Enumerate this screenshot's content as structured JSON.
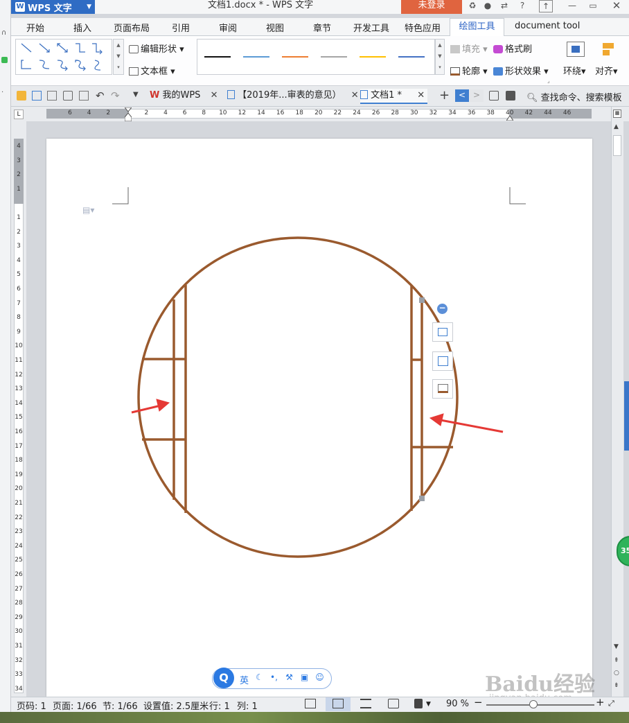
{
  "app": {
    "name": "WPS 文字",
    "window_title": "文档1.docx * - WPS 文字",
    "login_label": "未登录"
  },
  "menu": {
    "tabs": [
      "开始",
      "插入",
      "页面布局",
      "引用",
      "审阅",
      "视图",
      "章节",
      "开发工具",
      "特色应用"
    ],
    "active_tab": "绘图工具",
    "extra_tab": "document tool"
  },
  "ribbon": {
    "edit_shape": "编辑形状",
    "text_box": "文本框",
    "fill": "填充",
    "format_painter": "格式刷",
    "outline": "轮廓",
    "shape_effects": "形状效果",
    "wrap": "环绕",
    "align": "对齐",
    "line_colors": [
      "#111111",
      "#5b9bd5",
      "#ed7d31",
      "#a5a5a5",
      "#ffc000",
      "#4472c4"
    ]
  },
  "doc_tabs": {
    "my_wps": "我的WPS",
    "tab2": "【2019年...审表的意见）",
    "tab3": "文档1 *",
    "find": "查找命令、搜索模板"
  },
  "ruler": {
    "h_numbers": [
      "6",
      "4",
      "2",
      "",
      "2",
      "4",
      "6",
      "8",
      "10",
      "12",
      "14",
      "16",
      "18",
      "20",
      "22",
      "24",
      "26",
      "28",
      "30",
      "32",
      "34",
      "36",
      "38",
      "40",
      "42",
      "44",
      "46"
    ],
    "v_numbers": [
      "4",
      "3",
      "2",
      "1",
      "",
      "1",
      "2",
      "3",
      "4",
      "5",
      "6",
      "7",
      "8",
      "9",
      "10",
      "11",
      "12",
      "13",
      "14",
      "15",
      "16",
      "17",
      "18",
      "19",
      "20",
      "21",
      "22",
      "23",
      "24",
      "25",
      "26",
      "27",
      "28",
      "29",
      "30",
      "31",
      "32",
      "33",
      "34"
    ]
  },
  "shape_color": "#9a5a2e",
  "arrow_color": "#e53935",
  "ime": {
    "logo": "Q",
    "lang": "英"
  },
  "status": {
    "page_code": "页码: 1",
    "page": "页面: 1/66",
    "section": "节: 1/66",
    "setting": "设置值: 2.5厘米",
    "row": "行: 1",
    "col": "列: 1",
    "zoom": "90 %"
  },
  "badge": "35",
  "watermark": {
    "brand": "Baidu经验",
    "url": "jingyan.baidu.com"
  }
}
